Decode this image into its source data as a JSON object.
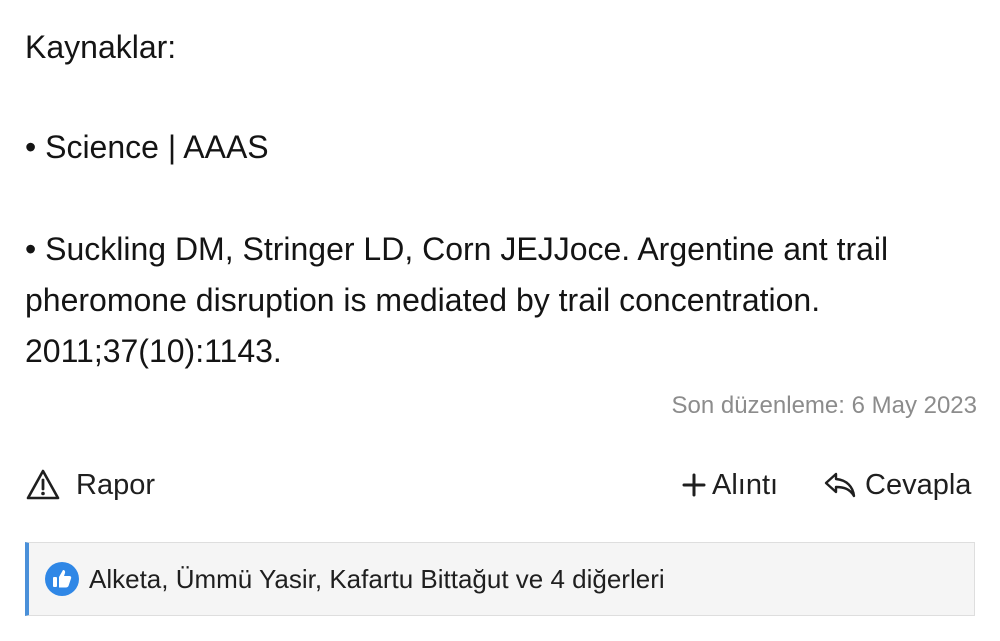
{
  "post": {
    "heading": "Kaynaklar:",
    "references": [
      "• Science | AAAS",
      "• Suckling DM, Stringer LD, Corn JEJJoce. Argentine ant trail pheromone disruption is mediated by trail concentration. 2011;37(10):1143."
    ],
    "edited": "Son düzenleme: 6 May 2023"
  },
  "actions": {
    "report": "Rapor",
    "quote": "Alıntı",
    "reply": "Cevapla"
  },
  "reactions": {
    "icon": "thumbs-up-icon",
    "text": "Alketa, Ümmü Yasir, Kafartu Bittağut ve 4 diğerleri"
  },
  "colors": {
    "accent": "#4a90d9",
    "like_badge": "#2f87e6",
    "muted_text": "#8c8c8c"
  }
}
